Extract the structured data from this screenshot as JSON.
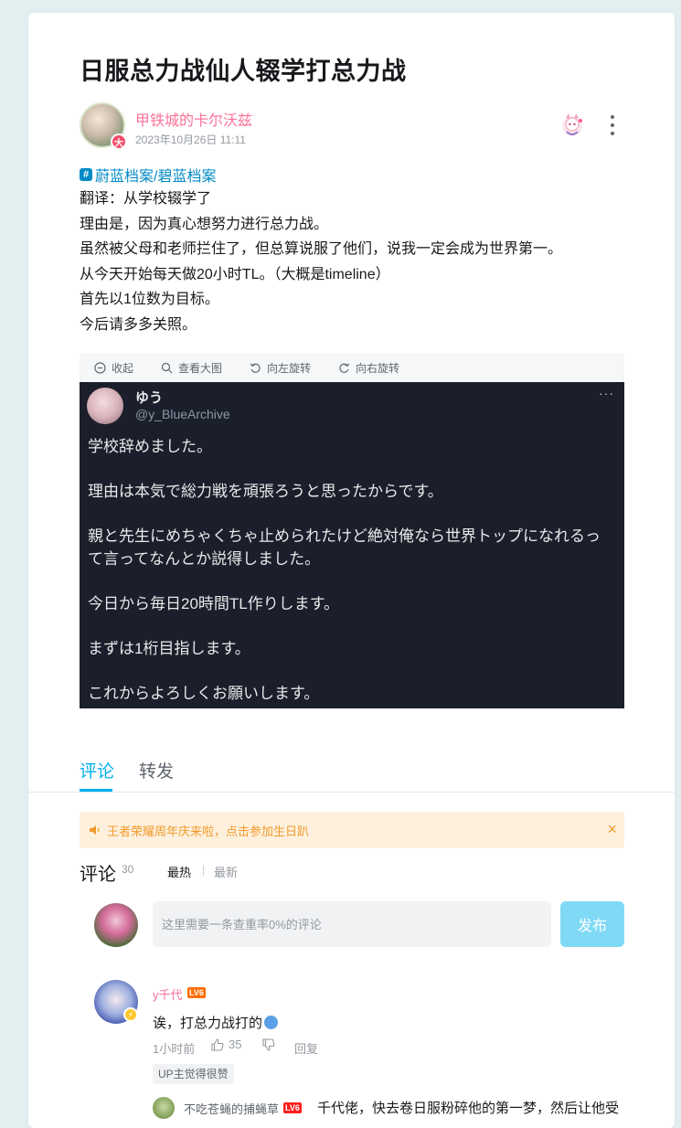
{
  "post": {
    "title": "日服总力战仙人辍学打总力战",
    "author": "甲铁城的卡尔沃兹",
    "date": "2023年10月26日 11:11",
    "avatar_badge": "大",
    "topic": "蔚蓝档案/碧蓝档案",
    "body": [
      "翻译：从学校辍学了",
      "理由是，因为真心想努力进行总力战。",
      "虽然被父母和老师拦住了，但总算说服了他们，说我一定会成为世界第一。",
      "从今天开始每天做20小时TL。（大概是timeline）",
      "首先以1位数为目标。",
      "今后请多多关照。"
    ]
  },
  "image_toolbar": {
    "collapse": "收起",
    "view_large": "查看大图",
    "rotate_left": "向左旋转",
    "rotate_right": "向右旋转"
  },
  "tweet": {
    "name": "ゆう",
    "handle": "@y_BlueArchive",
    "more": "···",
    "lines": [
      "学校辞めました。",
      "理由は本気で総力戦を頑張ろうと思ったからです。",
      "親と先生にめちゃくちゃ止められたけど絶対俺なら世界トップになれるっ",
      "て言ってなんとか説得しました。",
      "今日から毎日20時間TL作りします。",
      "まずは1桁目指します。",
      "これからよろしくお願いします。"
    ]
  },
  "tabs": {
    "comment": "评论",
    "repost": "转发"
  },
  "notice": {
    "text": "王者荣耀周年庆来啦，点击参加生日趴",
    "close": "×"
  },
  "comments": {
    "title": "评论",
    "count": "30",
    "sort_hot": "最热",
    "sort_sep": "|",
    "sort_new": "最新",
    "input_placeholder": "这里需要一条查重率0%的评论",
    "send": "发布"
  },
  "comment1": {
    "user": "y千代",
    "level": "LV6",
    "text": "诶，打总力战打的",
    "time": "1小时前",
    "likes": "35",
    "reply": "回复",
    "up_tag": "UP主觉得很赞"
  },
  "subcomment1": {
    "user": "不吃苍蝇的捕蝇草",
    "level": "LV6",
    "text": "千代佬，快去卷日服粉碎他的第一梦，然后让他受"
  },
  "colors": {
    "accent": "#00aeec",
    "username_pink": "#fb7299",
    "notice_bg": "#fdf0dd",
    "notice_text": "#f29b2b",
    "tweet_bg": "#1b1f2b",
    "send_button": "#80daf6"
  },
  "icons": {
    "more": "more-vertical-icon",
    "topic": "hashtag-icon",
    "collapse": "collapse-minus-circle-icon",
    "view_large": "search-icon",
    "rotate_left": "rotate-left-icon",
    "rotate_right": "rotate-right-icon",
    "notice": "speaker-icon",
    "like": "thumb-up-icon",
    "dislike": "thumb-down-icon"
  }
}
